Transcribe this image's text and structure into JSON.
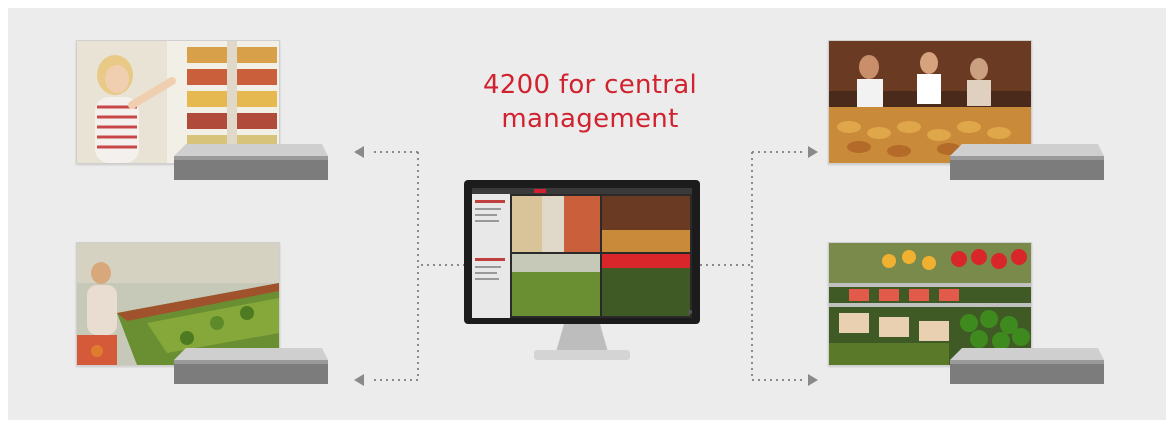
{
  "diagram": {
    "title_line1": "4200 for central",
    "title_line2": "management"
  },
  "colors": {
    "title": "#d0232f",
    "background": "#ececec",
    "connector": "#8a8a8a"
  },
  "icons": {
    "recorders": "nvr-recorder-icon",
    "monitor": "monitor-icon",
    "arrows": "arrow-head-icon"
  }
}
